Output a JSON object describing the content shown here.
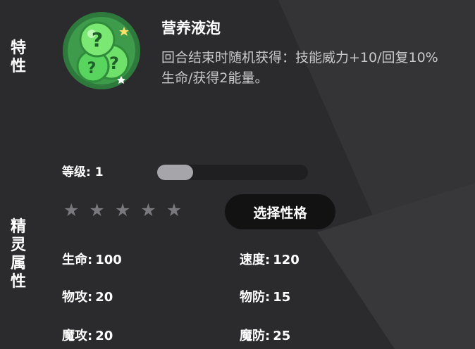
{
  "side_labels": {
    "trait": "特\n性",
    "attributes": "精\n灵\n属\n性"
  },
  "trait": {
    "name": "营养液泡",
    "description": "回合结束时随机获得：技能威力+10/回复10%生命/获得2能量。",
    "icon": "green-bubble-question-icon"
  },
  "level": {
    "label": "等级:",
    "value": "1",
    "progress_fraction": 0.24
  },
  "stars": {
    "filled": 0,
    "total": 5
  },
  "choose_button": "选择性格",
  "stats": {
    "hp": {
      "label": "生命:",
      "value": "100"
    },
    "speed": {
      "label": "速度:",
      "value": "120"
    },
    "phys_atk": {
      "label": "物攻:",
      "value": "20"
    },
    "phys_def": {
      "label": "物防:",
      "value": "15"
    },
    "mag_atk": {
      "label": "魔攻:",
      "value": "20"
    },
    "mag_def": {
      "label": "魔防:",
      "value": "25"
    }
  },
  "colors": {
    "background": "#2b2b2d",
    "button_bg": "#121212",
    "star_empty": "#7a7a7e",
    "bar_fill": "#a6a6aa",
    "icon_green": "#4fd35a"
  }
}
